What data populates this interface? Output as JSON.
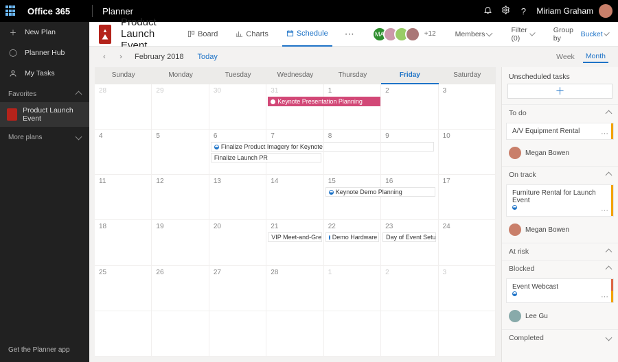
{
  "topbar": {
    "brand": "Office 365",
    "app": "Planner",
    "user": "Miriam Graham"
  },
  "leftnav": {
    "new_plan": "New Plan",
    "planner_hub": "Planner Hub",
    "my_tasks": "My Tasks",
    "favorites_label": "Favorites",
    "favorite_plan": "Product Launch Event",
    "more_plans": "More plans",
    "footer": "Get the Planner app"
  },
  "plan": {
    "title": "Product Launch Event",
    "tabs": {
      "board": "Board",
      "charts": "Charts",
      "schedule": "Schedule"
    },
    "members_label": "Members",
    "filter_label": "Filter (0)",
    "group_by_label": "Group by",
    "group_by_value": "Bucket",
    "people_overflow": "+12"
  },
  "calendar": {
    "month_label": "February 2018",
    "today_label": "Today",
    "view_week": "Week",
    "view_month": "Month",
    "days": [
      "Sunday",
      "Monday",
      "Tuesday",
      "Wednesday",
      "Thursday",
      "Friday",
      "Saturday"
    ],
    "cells": [
      [
        28,
        29,
        30,
        31,
        1,
        2,
        3
      ],
      [
        4,
        5,
        6,
        7,
        8,
        9,
        10
      ],
      [
        11,
        12,
        13,
        14,
        15,
        16,
        17
      ],
      [
        18,
        19,
        20,
        21,
        22,
        23,
        24
      ],
      [
        25,
        26,
        27,
        28,
        1,
        2,
        3
      ]
    ],
    "events": {
      "keynote_planning": "Keynote Presentation Planning",
      "finalize_imagery": "Finalize Product Imagery for Keynote",
      "finalize_pr": "Finalize Launch PR",
      "keynote_demo": "Keynote Demo Planning",
      "vip": "VIP Meet-and-Greet",
      "demo_hw": "Demo Hardware",
      "day_setup": "Day of Event Setup"
    }
  },
  "rpanel": {
    "unscheduled": "Unscheduled tasks",
    "todo": "To do",
    "ontrack": "On track",
    "atrisk": "At risk",
    "blocked": "Blocked",
    "completed": "Completed",
    "tasks": {
      "av": "A/V Equipment Rental",
      "furniture": "Furniture Rental for Launch Event",
      "webcast": "Event Webcast"
    },
    "assignees": {
      "megan": "Megan Bowen",
      "lee": "Lee Gu"
    }
  }
}
